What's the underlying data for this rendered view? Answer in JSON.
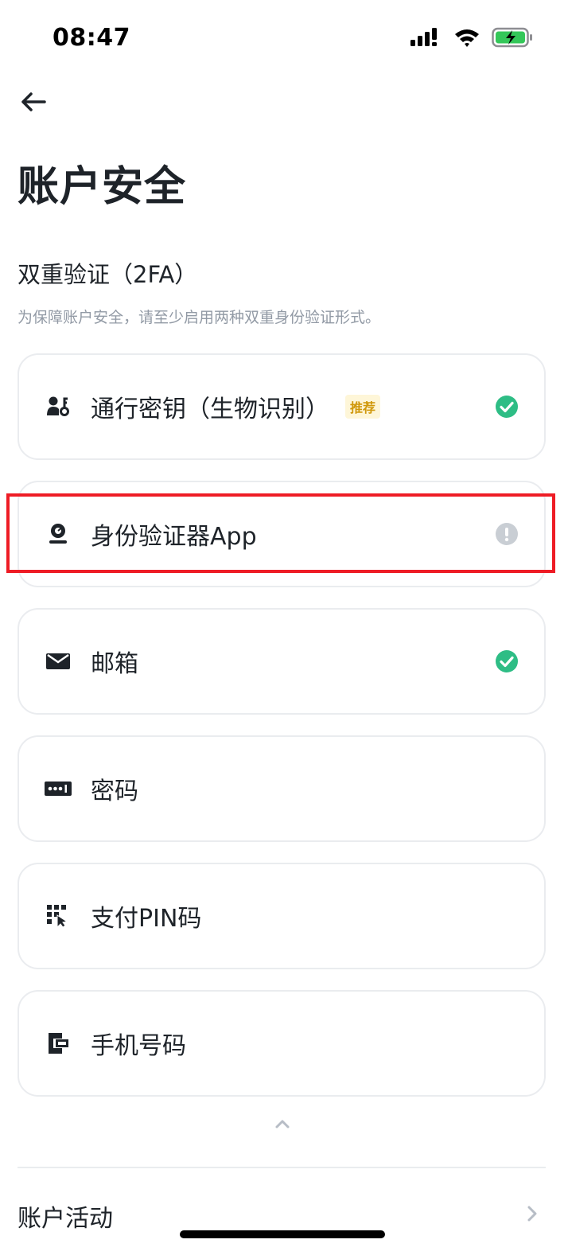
{
  "status_bar": {
    "time": "08:47"
  },
  "header": {
    "title": "账户安全"
  },
  "two_factor": {
    "title": "双重验证（2FA）",
    "description": "为保障账户安全，请至少启用两种双重身份验证形式。"
  },
  "options": [
    {
      "label": "通行密钥（生物识别）",
      "tag": "推荐",
      "icon": "passkey-icon",
      "status": "enabled"
    },
    {
      "label": "身份验证器App",
      "icon": "authenticator-icon",
      "status": "warning"
    },
    {
      "label": "邮箱",
      "icon": "email-icon",
      "status": "enabled"
    },
    {
      "label": "密码",
      "icon": "password-icon",
      "status": "none"
    },
    {
      "label": "支付PIN码",
      "icon": "pin-pad-icon",
      "status": "none"
    },
    {
      "label": "手机号码",
      "icon": "phone-icon",
      "status": "none"
    }
  ],
  "account_activity": {
    "label": "账户活动"
  },
  "colors": {
    "text_primary": "#1e2329",
    "text_secondary": "#929aa5",
    "success": "#2ebd85",
    "warning_gray": "#c9ced4",
    "tag_bg": "#fef6d8",
    "tag_text": "#d0980b",
    "highlight": "#ee1c25",
    "border": "#eaecef"
  }
}
